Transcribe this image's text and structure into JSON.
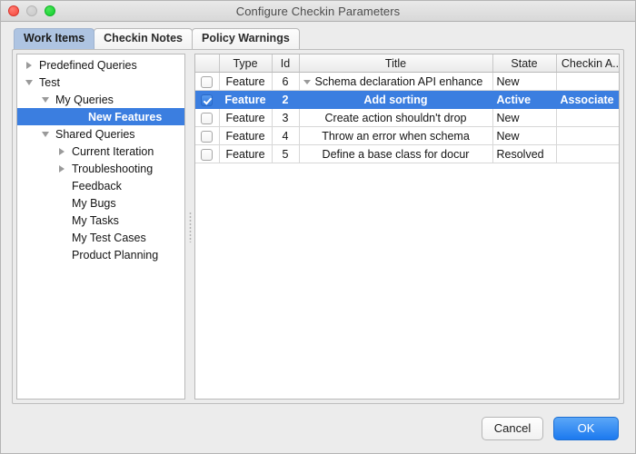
{
  "window": {
    "title": "Configure Checkin Parameters",
    "traffic": [
      {
        "name": "close-button",
        "color": "#f5453b"
      },
      {
        "name": "minimize-button",
        "color": "#c9c9c9"
      },
      {
        "name": "zoom-button",
        "color": "#12cd2d"
      }
    ]
  },
  "tabs": [
    {
      "label": "Work Items",
      "active": true
    },
    {
      "label": "Checkin Notes",
      "active": false
    },
    {
      "label": "Policy Warnings",
      "active": false
    }
  ],
  "tree": {
    "items": [
      {
        "label": "Predefined Queries",
        "indent": 0,
        "twisty": "right",
        "selected": false
      },
      {
        "label": "Test",
        "indent": 0,
        "twisty": "down",
        "selected": false
      },
      {
        "label": "My Queries",
        "indent": 1,
        "twisty": "down",
        "selected": false
      },
      {
        "label": "New Features",
        "indent": 3,
        "twisty": "none",
        "selected": true
      },
      {
        "label": "Shared Queries",
        "indent": 1,
        "twisty": "down",
        "selected": false
      },
      {
        "label": "Current Iteration",
        "indent": 2,
        "twisty": "right",
        "selected": false
      },
      {
        "label": "Troubleshooting",
        "indent": 2,
        "twisty": "right",
        "selected": false
      },
      {
        "label": "Feedback",
        "indent": 2,
        "twisty": "none",
        "selected": false
      },
      {
        "label": "My Bugs",
        "indent": 2,
        "twisty": "none",
        "selected": false
      },
      {
        "label": "My Tasks",
        "indent": 2,
        "twisty": "none",
        "selected": false
      },
      {
        "label": "My Test Cases",
        "indent": 2,
        "twisty": "none",
        "selected": false
      },
      {
        "label": "Product Planning",
        "indent": 2,
        "twisty": "none",
        "selected": false
      }
    ]
  },
  "table": {
    "columns": [
      "",
      "Type",
      "Id",
      "Title",
      "State",
      "Checkin A..."
    ],
    "rows": [
      {
        "checked": false,
        "type": "Feature",
        "id": "6",
        "title": "Schema declaration API enhance",
        "state": "New",
        "checkin_action": "",
        "selected": false,
        "expander": true
      },
      {
        "checked": true,
        "type": "Feature",
        "id": "2",
        "title": "Add sorting",
        "state": "Active",
        "checkin_action": "Associate",
        "selected": true,
        "expander": false
      },
      {
        "checked": false,
        "type": "Feature",
        "id": "3",
        "title": "Create action shouldn't drop",
        "state": "New",
        "checkin_action": "",
        "selected": false,
        "expander": false
      },
      {
        "checked": false,
        "type": "Feature",
        "id": "4",
        "title": "Throw an error when schema",
        "state": "New",
        "checkin_action": "",
        "selected": false,
        "expander": false
      },
      {
        "checked": false,
        "type": "Feature",
        "id": "5",
        "title": "Define a base class for docur",
        "state": "Resolved",
        "checkin_action": "",
        "selected": false,
        "expander": false
      }
    ]
  },
  "footer": {
    "cancel_label": "Cancel",
    "ok_label": "OK"
  },
  "colors": {
    "selection_blue": "#3b7ee0",
    "active_tab_blue": "#aec4e2",
    "primary_button_blue": "#1c79ef"
  }
}
